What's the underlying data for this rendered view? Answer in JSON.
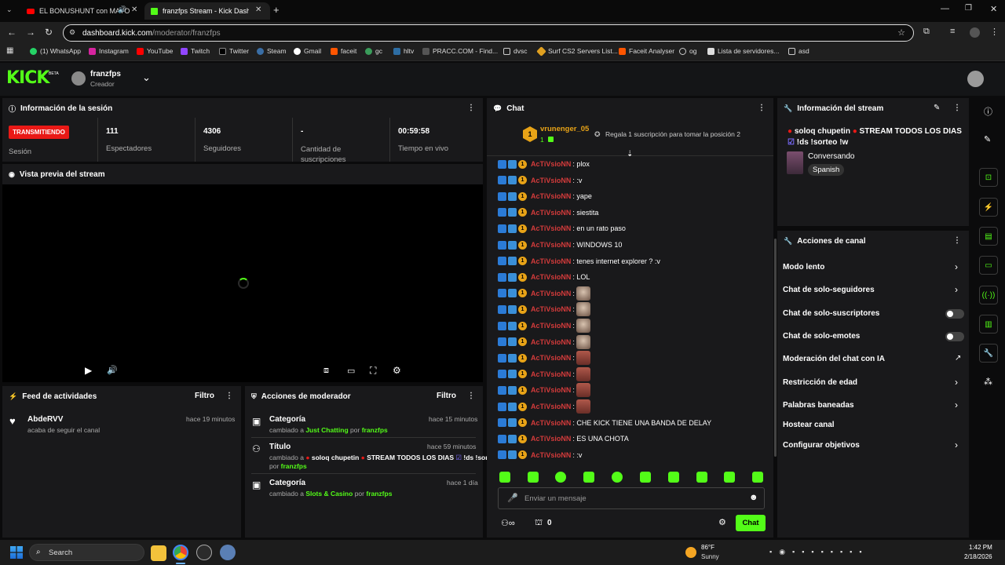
{
  "browser": {
    "tabs": [
      {
        "title": "EL BONUSHUNT con MAYO"
      },
      {
        "title": "franzfps Stream - Kick Dashboa"
      }
    ],
    "url_host": "dashboard.kick.com",
    "url_path": "/moderator/franzfps",
    "bookmarks": [
      "(1) WhatsApp",
      "Instagram",
      "YouTube",
      "Twitch",
      "Twitter",
      "Steam",
      "Gmail",
      "faceit",
      "gc",
      "hltv",
      "PRACC.COM - Find...",
      "dvsc",
      "Surf CS2 Servers List...",
      "Faceit Analyser",
      "og",
      "Lista de servidores...",
      "asd"
    ]
  },
  "header": {
    "logo_text": "KICK",
    "logo_badge": "BETA",
    "username": "franzfps",
    "role": "Creador"
  },
  "session": {
    "title": "Información de la sesión",
    "live_badge": "TRANSMITIENDO",
    "session_label": "Sesión",
    "stats": [
      {
        "value": "111",
        "label": "Espectadores"
      },
      {
        "value": "4306",
        "label": "Seguidores"
      },
      {
        "value": "-",
        "label": "Cantidad de suscripciones"
      },
      {
        "value": "00:59:58",
        "label": "Tiempo en vivo"
      }
    ]
  },
  "preview": {
    "title": "Vista previa del stream"
  },
  "feed": {
    "title": "Feed de actividades",
    "filter": "Filtro",
    "items": [
      {
        "user": "AbdeRVV",
        "action": "acaba de seguir el canal",
        "time": "hace 19 minutos"
      }
    ]
  },
  "modactions": {
    "title": "Acciones de moderador",
    "filter": "Filtro",
    "items": [
      {
        "heading": "Categoría",
        "time": "hace 15 minutos",
        "prefix": "cambiado a",
        "value": "Just Chatting",
        "by": "por",
        "user": "franzfps"
      },
      {
        "heading": "Título",
        "time": "hace 59 minutos",
        "prefix": "cambiado a",
        "value": "soloq chupetin",
        "value2": "STREAM TODOS LOS DIAS",
        "value3": "!ds !sorteo !w",
        "by": "por",
        "user": "franzfps"
      },
      {
        "heading": "Categoría",
        "time": "hace 1 día",
        "prefix": "cambiado a",
        "value": "Slots & Casino",
        "by": "por",
        "user": "franzfps"
      }
    ]
  },
  "chat": {
    "title": "Chat",
    "pinned_user": "vrunenger_05",
    "pinned_count": "1",
    "gift_text": "Regala 1 suscripción para tomar la posición 2",
    "username": "AcTiVsioNN",
    "messages": [
      ": plox",
      ": :v",
      ": yape",
      ": siestita",
      ": en un rato paso",
      ": WINDOWS 10",
      ": tenes internet explorer ? :v",
      ": LOL",
      ":",
      ":",
      ":",
      ":",
      ":",
      ":",
      ":",
      ":",
      ": CHE KICK TIENE UNA BANDA DE DELAY",
      ": ES UNA CHOTA",
      ": :v"
    ],
    "placeholder": "Enviar un mensaje",
    "count": "0",
    "send": "Chat"
  },
  "streaminfo": {
    "title": "Información del stream",
    "line1": "soloq chupetin",
    "line1b": "STREAM TODOS LOS DIAS",
    "line2": "!ds !sorteo !w",
    "category": "Conversando",
    "language": "Spanish"
  },
  "channel": {
    "title": "Acciones de canal",
    "items": [
      "Modo lento",
      "Chat de solo-seguidores",
      "Chat de solo-suscriptores",
      "Chat de solo-emotes",
      "Moderación del chat con IA",
      "Restricción de edad",
      "Palabras baneadas",
      "Hostear canal",
      "Configurar objetivos"
    ]
  },
  "taskbar": {
    "search": "Search",
    "temp": "86°F",
    "weather": "Sunny",
    "time": "1:42 PM",
    "date": "2/18/2026"
  },
  "colors": {
    "accent": "#53fc18",
    "live": "#e91916",
    "username": "#d43b3b"
  }
}
